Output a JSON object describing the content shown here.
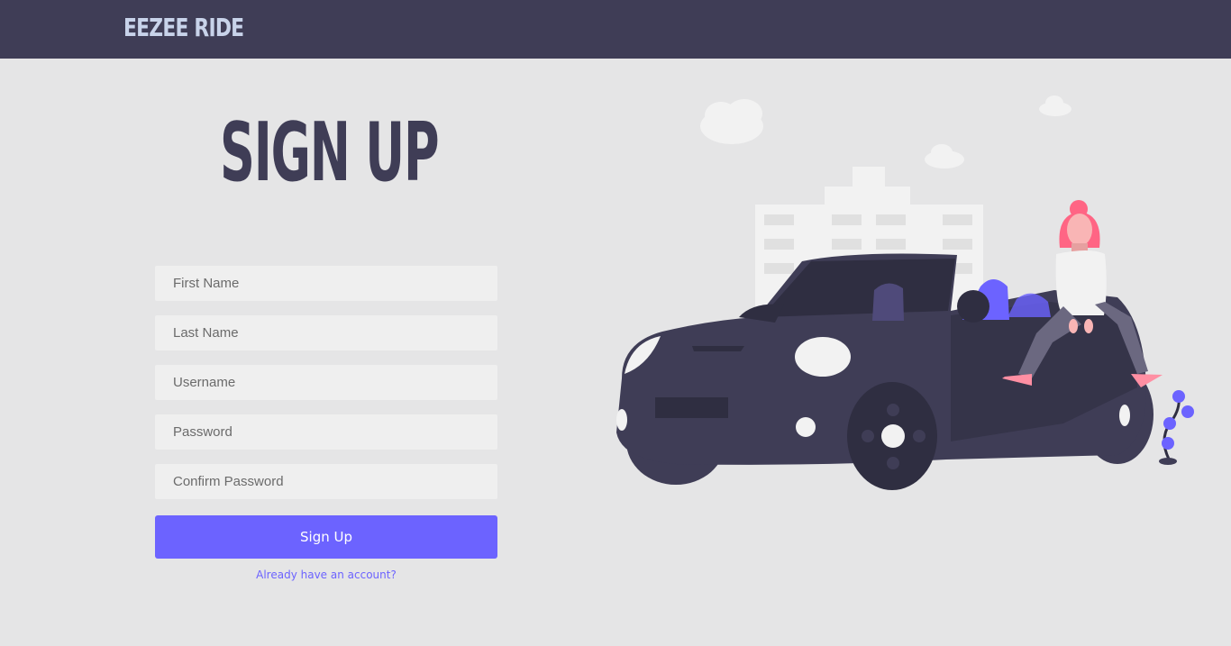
{
  "brand": {
    "name": "EEZEE RIDE"
  },
  "page": {
    "title": "SIGN UP"
  },
  "form": {
    "fields": [
      {
        "placeholder": "First Name"
      },
      {
        "placeholder": "Last Name"
      },
      {
        "placeholder": "Username"
      },
      {
        "placeholder": "Password"
      },
      {
        "placeholder": "Confirm Password"
      }
    ],
    "submit_label": "Sign Up",
    "login_link": "Already have an account?"
  },
  "colors": {
    "navbar": "#3f3d56",
    "background": "#e5e5e6",
    "accent": "#6c63ff",
    "brand_text": "#c8d3ea"
  },
  "illustration": {
    "icon": "car-with-woman-illustration"
  }
}
